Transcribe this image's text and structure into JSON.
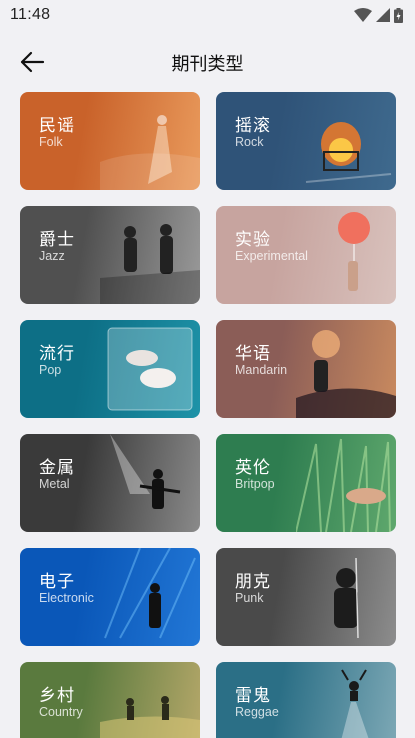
{
  "status_bar": {
    "time": "11:48"
  },
  "header": {
    "title": "期刊类型"
  },
  "genres": [
    {
      "cn": "民谣",
      "en": "Folk",
      "bg": "#c9622a",
      "bg2": "#e99a5c",
      "image": "desert-dancer"
    },
    {
      "cn": "摇滚",
      "en": "Rock",
      "bg": "#2f5378",
      "bg2": "#3f6a8e",
      "image": "burning-cart"
    },
    {
      "cn": "爵士",
      "en": "Jazz",
      "bg": "#505050",
      "bg2": "#9a9a9a",
      "image": "couple-holding-hands"
    },
    {
      "cn": "实验",
      "en": "Experimental",
      "bg": "#c7a49f",
      "bg2": "#d9c2bd",
      "image": "red-balloon"
    },
    {
      "cn": "流行",
      "en": "Pop",
      "bg": "#0d6f86",
      "bg2": "#1e93a8",
      "image": "couple-in-bed"
    },
    {
      "cn": "华语",
      "en": "Mandarin",
      "bg": "#8b5d57",
      "bg2": "#c98a5f",
      "image": "sunset-silhouette"
    },
    {
      "cn": "金属",
      "en": "Metal",
      "bg": "#3a3a3a",
      "bg2": "#8a8a8a",
      "image": "guitarist-on-stage"
    },
    {
      "cn": "英伦",
      "en": "Britpop",
      "bg": "#2e7d50",
      "bg2": "#5fa86d",
      "image": "hand-in-grass"
    },
    {
      "cn": "电子",
      "en": "Electronic",
      "bg": "#0a57b8",
      "bg2": "#2277d6",
      "image": "dj-with-lights"
    },
    {
      "cn": "朋克",
      "en": "Punk",
      "bg": "#4a4a4a",
      "bg2": "#8d8d8d",
      "image": "punk-singer"
    },
    {
      "cn": "乡村",
      "en": "Country",
      "bg": "#5a7a3e",
      "bg2": "#b6a86a",
      "image": "people-in-field"
    },
    {
      "cn": "雷鬼",
      "en": "Reggae",
      "bg": "#2b6f86",
      "bg2": "#7ea9b6",
      "image": "deer-on-road"
    }
  ]
}
